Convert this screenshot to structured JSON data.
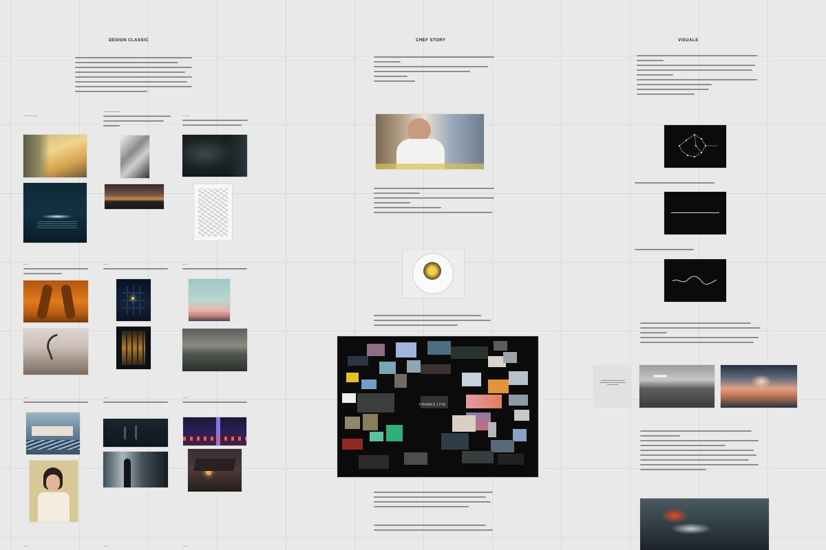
{
  "columns": [
    {
      "title": "DESIGN CLASSIC"
    },
    {
      "title": "CHEF STORY"
    },
    {
      "title": "VISUALS"
    }
  ],
  "mosaic": {
    "label": "FRAMES LIVE"
  },
  "note_card": {
    "line1": "",
    "line2": ""
  },
  "colors": {
    "board": "#e9e9e9",
    "grid": "#dadada",
    "text_line": "#8d8d8d",
    "dark_frame": "#0b0b0b"
  },
  "icons": [
    "moon-icon"
  ]
}
